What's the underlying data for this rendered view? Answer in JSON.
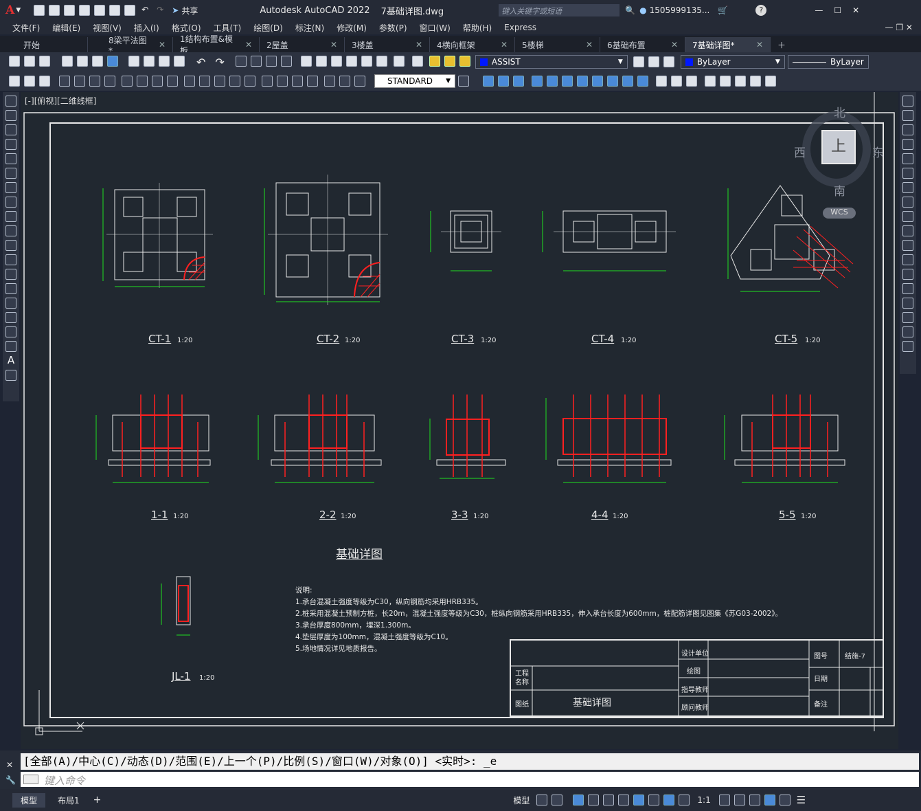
{
  "app": {
    "title": "Autodesk AutoCAD 2022",
    "file": "7基础详图.dwg",
    "search_placeholder": "键入关键字或短语",
    "user": "1505999135...",
    "share": "共享"
  },
  "menus": [
    "文件(F)",
    "编辑(E)",
    "视图(V)",
    "插入(I)",
    "格式(O)",
    "工具(T)",
    "绘图(D)",
    "标注(N)",
    "修改(M)",
    "参数(P)",
    "窗口(W)",
    "帮助(H)",
    "Express"
  ],
  "tabs": [
    {
      "label": "开始",
      "close": false,
      "active": false
    },
    {
      "label": "8梁平法图*",
      "close": true,
      "active": false
    },
    {
      "label": "1结构布置&模板",
      "close": true,
      "active": false
    },
    {
      "label": "2屋盖",
      "close": true,
      "active": false
    },
    {
      "label": "3楼盖",
      "close": true,
      "active": false
    },
    {
      "label": "4横向框架",
      "close": true,
      "active": false
    },
    {
      "label": "5楼梯",
      "close": true,
      "active": false
    },
    {
      "label": "6基础布置",
      "close": true,
      "active": false
    },
    {
      "label": "7基础详图*",
      "close": true,
      "active": true
    }
  ],
  "layer_select": "ASSIST",
  "color_select": "ByLayer",
  "linetype_select": "ByLayer",
  "textstyle_select": "STANDARD",
  "viewport_label": "[-][俯视][二维线框]",
  "viewcube": {
    "north": "北",
    "south": "南",
    "east": "东",
    "west": "西",
    "top": "上",
    "wcs": "WCS"
  },
  "drawing": {
    "plan_titles": [
      {
        "name": "CT-1",
        "scale": "1:20"
      },
      {
        "name": "CT-2",
        "scale": "1:20"
      },
      {
        "name": "CT-3",
        "scale": "1:20"
      },
      {
        "name": "CT-4",
        "scale": "1:20"
      },
      {
        "name": "CT-5",
        "scale": "1:20"
      }
    ],
    "section_titles": [
      {
        "name": "1-1",
        "scale": "1:20"
      },
      {
        "name": "2-2",
        "scale": "1:20"
      },
      {
        "name": "3-3",
        "scale": "1:20"
      },
      {
        "name": "4-4",
        "scale": "1:20"
      },
      {
        "name": "5-5",
        "scale": "1:20"
      }
    ],
    "main_title": "基础详图",
    "beam_title": {
      "name": "JL-1",
      "scale": "1:20"
    },
    "notes_heading": "说明:",
    "notes": [
      "1.承台混凝土强度等级为C30，纵向钢筋均采用HRB335。",
      "2.桩采用混凝土预制方桩，长20m，混凝土强度等级为C30，桩纵向钢筋采用HRB335，伸入承台长度为600mm，桩配筋详图见图集《苏G03-2002》。",
      "3.承台厚度800mm，埋深1.300m。",
      "4.垫层厚度为100mm，混凝土强度等级为C10。",
      "5.场地情况详见地质报告。"
    ],
    "title_block": {
      "design_unit": "设计单位",
      "drawing": "绘图",
      "advisor": "指导教师",
      "reviewer": "顾问教师",
      "project": "工程\n名称",
      "sheet_label": "图纸",
      "sheet_name": "基础详图",
      "drawing_no_label": "图号",
      "drawing_no": "结施-7",
      "date_label": "日期",
      "remark_label": "备注"
    }
  },
  "command_history": "[全部(A)/中心(C)/动态(D)/范围(E)/上一个(P)/比例(S)/窗口(W)/对象(O)] <实时>: _e",
  "command_placeholder": "键入命令",
  "layout_tabs": [
    "模型",
    "布局1"
  ],
  "status": {
    "model": "模型",
    "scale": "1:1"
  }
}
